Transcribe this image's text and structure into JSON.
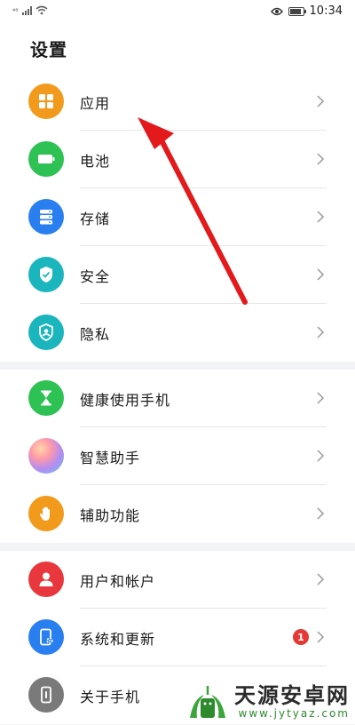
{
  "statusbar": {
    "signal": "⁴⁶",
    "time": "10:34"
  },
  "page": {
    "title": "设置"
  },
  "groups": [
    {
      "items": [
        {
          "label": "应用",
          "icon": "apps-grid-icon",
          "color": "#f29a1b"
        },
        {
          "label": "电池",
          "icon": "battery-icon",
          "color": "#2ec255"
        },
        {
          "label": "存储",
          "icon": "storage-icon",
          "color": "#2a7ff0"
        },
        {
          "label": "安全",
          "icon": "shield-check-icon",
          "color": "#1ab5bd"
        },
        {
          "label": "隐私",
          "icon": "privacy-shield-icon",
          "color": "#1ab5bd"
        }
      ]
    },
    {
      "items": [
        {
          "label": "健康使用手机",
          "icon": "hourglass-icon",
          "color": "#2ec255"
        },
        {
          "label": "智慧助手",
          "icon": "smart-assistant-icon",
          "color": "gradient"
        },
        {
          "label": "辅助功能",
          "icon": "hand-icon",
          "color": "#f29a1b"
        }
      ]
    },
    {
      "items": [
        {
          "label": "用户和帐户",
          "icon": "user-icon",
          "color": "#e8383d"
        },
        {
          "label": "系统和更新",
          "icon": "phone-settings-icon",
          "color": "#2a7ff0",
          "badge": "1"
        },
        {
          "label": "关于手机",
          "icon": "phone-info-icon",
          "color": "#7a7a7a"
        }
      ]
    }
  ],
  "watermark": {
    "text": "天源安卓网",
    "url": "www.jytyaz.com"
  }
}
